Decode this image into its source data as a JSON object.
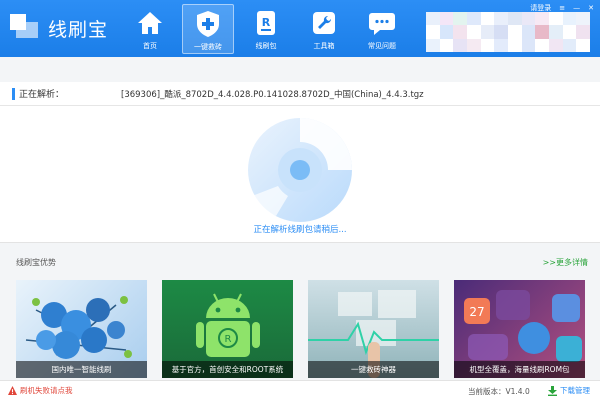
{
  "app": {
    "logo_text": "线刷宝",
    "colors": {
      "header": "#1b7ee8",
      "accent": "#2c8ef5",
      "green": "#2aa43b",
      "warning": "#e0463a"
    }
  },
  "nav": [
    {
      "label": "首页",
      "icon": "home-icon"
    },
    {
      "label": "一键救砖",
      "icon": "plus-shield-icon"
    },
    {
      "label": "线刷包",
      "icon": "rom-package-icon"
    },
    {
      "label": "工具箱",
      "icon": "wrench-icon"
    },
    {
      "label": "常见问题",
      "icon": "chat-bubble-icon"
    }
  ],
  "window": {
    "login_label": "请登录",
    "menu_icon": "menu-icon",
    "minimize": "—",
    "close": "✕"
  },
  "parsing": {
    "label": "正在解析：",
    "file": "[369306]_酷派_8702D_4.4.028.P0.141028.8702D_中国(China)_4.4.3.tgz"
  },
  "status_text": "正在解析线刷包请稍后...",
  "advantages": {
    "title": "线刷宝优势",
    "more": ">>更多详情",
    "cards": [
      {
        "caption": "国内唯一智能线刷"
      },
      {
        "caption": "基于官方，首创安全和ROOT系统"
      },
      {
        "caption": "一键救砖神器"
      },
      {
        "caption": "机型全覆盖，海量线刷ROM包"
      }
    ]
  },
  "footer": {
    "fail_text": "刷机失败请点我",
    "version_text": "当前版本：V1.4.0",
    "download_manager": "下载管理"
  }
}
